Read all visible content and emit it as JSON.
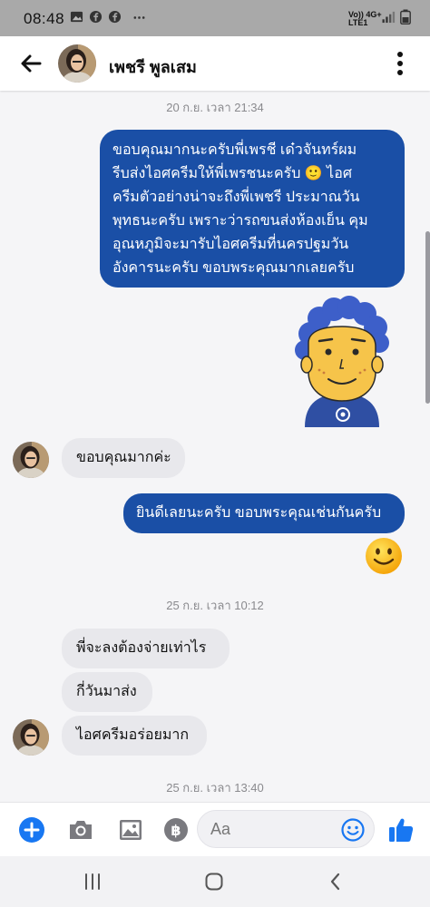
{
  "status_bar": {
    "time": "08:48",
    "network_top": "Vo))  4G+",
    "network_bottom": "LTE1"
  },
  "header": {
    "contact_name": "เพชรี พูลเสม",
    "icons": [
      "back-arrow-icon",
      "avatar",
      "more-vertical-icon"
    ]
  },
  "conversation": {
    "timestamp_1": "20 ก.ย. เวลา 21:34",
    "msg1_lines": [
      "ขอบคุณมากนะครับพี่เพรชี เด๋วจันทร์ผม",
      "รีบส่งไอศครีมให้พี่เพรชนะครับ 🙂 ไอศ",
      "ครีมตัวอย่างน่าจะถึงพี่เพชรี ประมาณวัน",
      "พุทธนะครับ เพราะว่ารถขนส่งห้องเย็น คุม",
      "อุณหภูมิจะมารับไอศครีมที่นครปฐมวัน",
      "อังคารนะครับ ขอบพระคุณมากเลยครับ"
    ],
    "msg2": "ขอบคุณมากค่ะ",
    "msg3": "ยินดีเลยนะครับ ขอบพระคุณเช่นกันครับ",
    "timestamp_2": "25 ก.ย. เวลา 10:12",
    "msg4": "พี่จะลงต้องจ่ายเท่าไร",
    "msg5": "กี่วันมาส่ง",
    "msg6": "ไอศครีมอร่อยมาก",
    "timestamp_3": "25 ก.ย. เวลา 13:40"
  },
  "composer": {
    "placeholder": "Aa",
    "icons": [
      "plus-icon",
      "camera-icon",
      "gallery-icon",
      "payment-icon",
      "emoji-icon",
      "thumbs-up-icon"
    ]
  },
  "colors": {
    "accent": "#1877f2",
    "outgoing_bubble": "#1a4fa6",
    "incoming_bubble": "#e8e8ec",
    "status_bar": "#a9a9a9"
  }
}
